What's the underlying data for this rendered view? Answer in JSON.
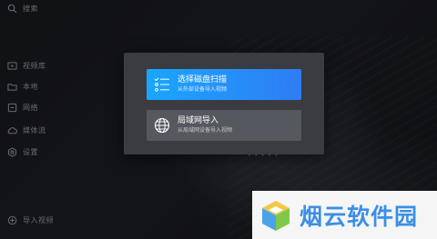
{
  "sidebar": {
    "search_label": "搜索",
    "items": [
      {
        "label": "视频库",
        "icon": "video-library-icon"
      },
      {
        "label": "本地",
        "icon": "folder-icon"
      },
      {
        "label": "网络",
        "icon": "network-icon"
      },
      {
        "label": "媒体流",
        "icon": "cloud-icon"
      },
      {
        "label": "设置",
        "icon": "gear-icon"
      }
    ],
    "import_label": "导入视频"
  },
  "dialog": {
    "options": [
      {
        "title": "选择磁盘扫描",
        "subtitle": "从外部设备导入视频",
        "icon": "disk-scan-icon"
      },
      {
        "title": "局域网导入",
        "subtitle": "从局域网设备导入视频",
        "icon": "globe-icon"
      }
    ]
  },
  "background": {
    "dots_text": "• • • • •"
  },
  "watermark": {
    "text": "烟云软件园",
    "logo": "cube-logo-icon"
  },
  "colors": {
    "accent_start": "#1aa6ff",
    "accent_end": "#2f7df3",
    "dialog_bg": "#3a3c41",
    "watermark_text": "#3b8ee8"
  }
}
